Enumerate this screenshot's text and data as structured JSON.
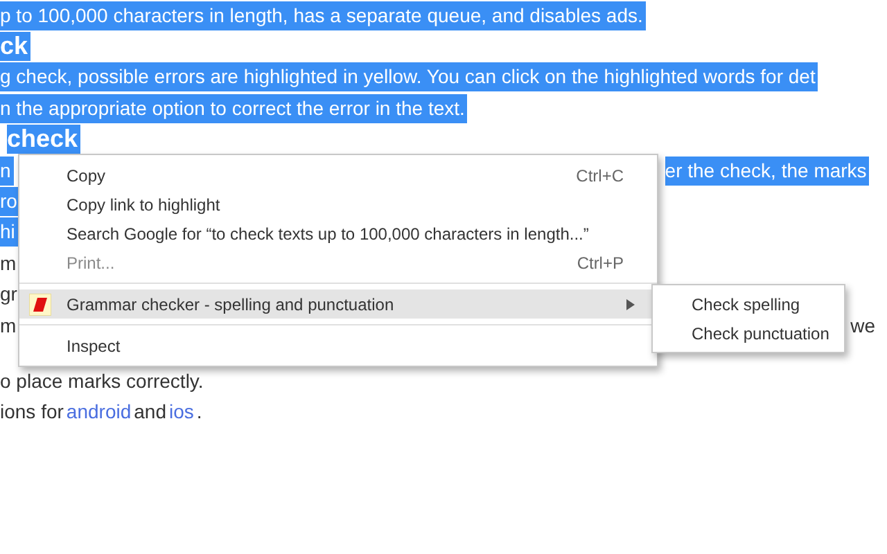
{
  "page": {
    "lines": [
      {
        "kind": "text",
        "selected": true,
        "segments": [
          {
            "text": "p to 100,000 characters in length, has a separate queue, and disables ads."
          }
        ]
      },
      {
        "kind": "heading",
        "selected": true,
        "segments": [
          {
            "text": "ck"
          }
        ]
      },
      {
        "kind": "text",
        "selected": true,
        "segments": [
          {
            "text": "g check, possible errors are highlighted in yellow. You can click on the highlighted words for det"
          }
        ]
      },
      {
        "kind": "text",
        "selected": true,
        "segments": [
          {
            "text": "n the appropriate option to correct the error in the text."
          }
        ]
      },
      {
        "kind": "heading",
        "selected": true,
        "segments": [
          {
            "text": "check",
            "indent": true
          }
        ]
      },
      {
        "kind": "text",
        "selected": true,
        "segments": [
          {
            "text": "n"
          },
          {
            "text": "er the check, the marks",
            "after_menu": true
          }
        ]
      },
      {
        "kind": "text",
        "selected": true,
        "segments": [
          {
            "text": "ro"
          }
        ]
      },
      {
        "kind": "text",
        "selected": true,
        "segments": [
          {
            "text": "hi"
          }
        ]
      },
      {
        "kind": "text",
        "selected": false,
        "segments": [
          {
            "text": "m"
          }
        ]
      },
      {
        "kind": "text",
        "selected": false,
        "segments": [
          {
            "text": "gr"
          }
        ]
      },
      {
        "kind": "text",
        "selected": false,
        "segments": [
          {
            "text": "m"
          },
          {
            "text": "we",
            "after_submenu": true
          }
        ]
      },
      {
        "kind": "text",
        "selected": false,
        "segments": [
          {
            "text": "o place marks correctly."
          }
        ]
      },
      {
        "kind": "text",
        "selected": false,
        "segments": [
          {
            "text": "ions for "
          },
          {
            "text": "android",
            "link": true
          },
          {
            "text": " and "
          },
          {
            "text": "ios",
            "link": true
          },
          {
            "text": "."
          }
        ]
      }
    ]
  },
  "context_menu": {
    "items": [
      {
        "kind": "item",
        "label": "Copy",
        "shortcut": "Ctrl+C",
        "disabled": false,
        "selected": false
      },
      {
        "kind": "item",
        "label": "Copy link to highlight",
        "disabled": false,
        "selected": false
      },
      {
        "kind": "item",
        "label": "Search Google for “to check texts up to 100,000 characters in length...”",
        "disabled": false,
        "selected": false
      },
      {
        "kind": "item",
        "label": "Print...",
        "shortcut": "Ctrl+P",
        "disabled": true,
        "selected": false
      },
      {
        "kind": "separator"
      },
      {
        "kind": "submenu",
        "label": "Grammar checker - spelling and punctuation",
        "selected": true,
        "disabled": false
      },
      {
        "kind": "separator"
      },
      {
        "kind": "item",
        "label": "Inspect",
        "disabled": false,
        "selected": false
      }
    ]
  },
  "submenu": {
    "items": [
      {
        "label": "Check spelling"
      },
      {
        "label": "Check punctuation"
      }
    ]
  }
}
